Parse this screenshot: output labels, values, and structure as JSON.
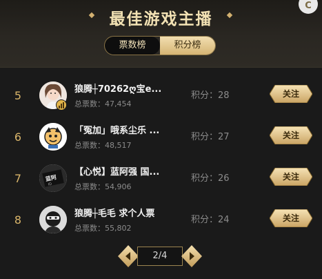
{
  "header": {
    "title": "最佳游戏主播",
    "corner_icon": "c-logo-icon"
  },
  "tabs": [
    {
      "label": "票数榜",
      "active": true
    },
    {
      "label": "积分榜",
      "active": false
    }
  ],
  "rows": [
    {
      "rank": "5",
      "name": "狼腾┼70262ღ宝e...",
      "votes": "总票数：47,454",
      "score": "积分：28",
      "follow": "关注",
      "avatar": "avatar-girl",
      "badge": "level-bars-icon"
    },
    {
      "rank": "6",
      "name": "「冤加」哦系尘乐 ...",
      "votes": "总票数：48,517",
      "score": "积分：27",
      "follow": "关注",
      "avatar": "avatar-cartoon"
    },
    {
      "rank": "7",
      "name": "【心悦】蓝阿强 国...",
      "votes": "总票数：54,906",
      "score": "积分：26",
      "follow": "关注",
      "avatar": "avatar-dark-logo"
    },
    {
      "rank": "8",
      "name": "狼腾┼毛毛 求个人票",
      "votes": "总票数：55,802",
      "score": "积分：24",
      "follow": "关注",
      "avatar": "avatar-masked"
    }
  ],
  "pagination": {
    "text": "2/4",
    "current": 2,
    "total": 4
  },
  "colors": {
    "gold": "#d9b56a",
    "background": "#1a1a1a"
  }
}
